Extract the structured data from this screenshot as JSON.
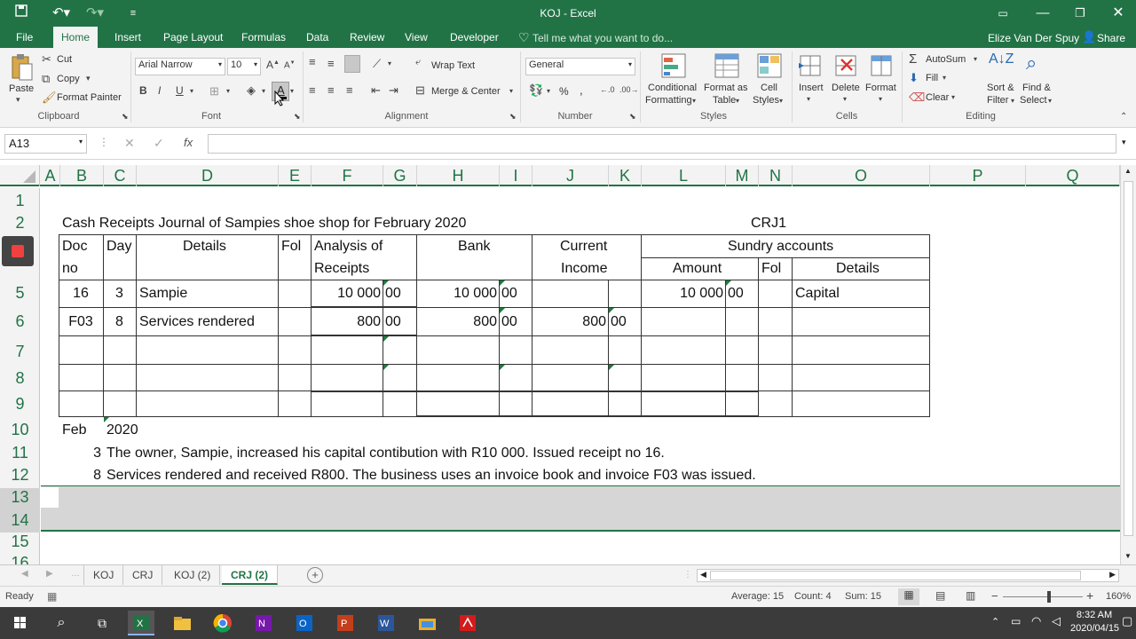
{
  "window": {
    "title": "KOJ - Excel",
    "signin_user": "Elize Van Der Spuy",
    "share_label": "Share"
  },
  "tabs": [
    "File",
    "Home",
    "Insert",
    "Page Layout",
    "Formulas",
    "Data",
    "Review",
    "View",
    "Developer"
  ],
  "tell_me": "Tell me what you want to do...",
  "ribbon": {
    "clipboard": {
      "paste": "Paste",
      "cut": "Cut",
      "copy": "Copy",
      "format_painter": "Format Painter",
      "label": "Clipboard"
    },
    "font": {
      "name": "Arial Narrow",
      "size": "10",
      "bold": "B",
      "italic": "I",
      "underline": "U",
      "label": "Font"
    },
    "alignment": {
      "wrap": "Wrap Text",
      "merge": "Merge & Center",
      "label": "Alignment"
    },
    "number": {
      "format": "General",
      "percent": "%",
      "comma": ",",
      "label": "Number"
    },
    "styles": {
      "conditional": "Conditional",
      "conditional2": "Formatting",
      "format_table": "Format as",
      "format_table2": "Table",
      "cell_styles": "Cell",
      "cell_styles2": "Styles",
      "label": "Styles"
    },
    "cells": {
      "insert": "Insert",
      "delete": "Delete",
      "format": "Format",
      "label": "Cells"
    },
    "editing": {
      "autosum": "AutoSum",
      "fill": "Fill",
      "clear": "Clear",
      "sort": "Sort &",
      "sort2": "Filter",
      "find": "Find &",
      "find2": "Select",
      "label": "Editing"
    }
  },
  "formula_bar": {
    "name_box": "A13",
    "fx": "fx",
    "value": ""
  },
  "columns": [
    "A",
    "B",
    "C",
    "D",
    "E",
    "F",
    "G",
    "H",
    "I",
    "J",
    "K",
    "L",
    "M",
    "N",
    "O",
    "P",
    "Q"
  ],
  "rows": [
    "1",
    "2",
    "3",
    "4",
    "5",
    "6",
    "7",
    "8",
    "9",
    "10",
    "11",
    "12",
    "13",
    "14",
    "15",
    "16"
  ],
  "sheet": {
    "title": "Cash Receipts Journal of Sampies shoe shop for February 2020",
    "code": "CRJ1",
    "headers": {
      "doc": "Doc",
      "doc2": "no",
      "day": "Day",
      "details": "Details",
      "fol": "Fol",
      "analysis": "Analysis of",
      "analysis2": "Receipts",
      "bank": "Bank",
      "current": "Current",
      "current2": "Income",
      "sundry": "Sundry accounts",
      "amount": "Amount",
      "sfol": "Fol",
      "sdetails": "Details"
    },
    "entries": [
      {
        "doc": "16",
        "day": "3",
        "details": "Sampie",
        "analysis": "10 000",
        "analysis_c": "00",
        "bank": "10 000",
        "bank_c": "00",
        "current": "",
        "current_c": "",
        "amount": "10 000",
        "amount_c": "00",
        "sdetails": "Capital"
      },
      {
        "doc": "F03",
        "day": "8",
        "details": "Services rendered",
        "analysis": "800",
        "analysis_c": "00",
        "bank": "800",
        "bank_c": "00",
        "current": "800",
        "current_c": "00",
        "amount": "",
        "amount_c": "",
        "sdetails": ""
      }
    ],
    "notes": {
      "month": "Feb",
      "year": "2020",
      "n1_day": "3",
      "n1_text": "The owner, Sampie, increased his capital contibution with R10 000. Issued receipt no 16.",
      "n2_day": "8",
      "n2_text": "Services rendered and received R800. The business uses an invoice book and invoice F03 was issued."
    }
  },
  "sheet_tabs": [
    "KOJ",
    "CRJ",
    "KOJ (2)",
    "CRJ  (2)"
  ],
  "status": {
    "ready": "Ready",
    "average": "Average: 15",
    "count": "Count: 4",
    "sum": "Sum: 15",
    "zoom": "160%"
  },
  "taskbar": {
    "time": "8:32 AM",
    "date": "2020/04/15"
  }
}
